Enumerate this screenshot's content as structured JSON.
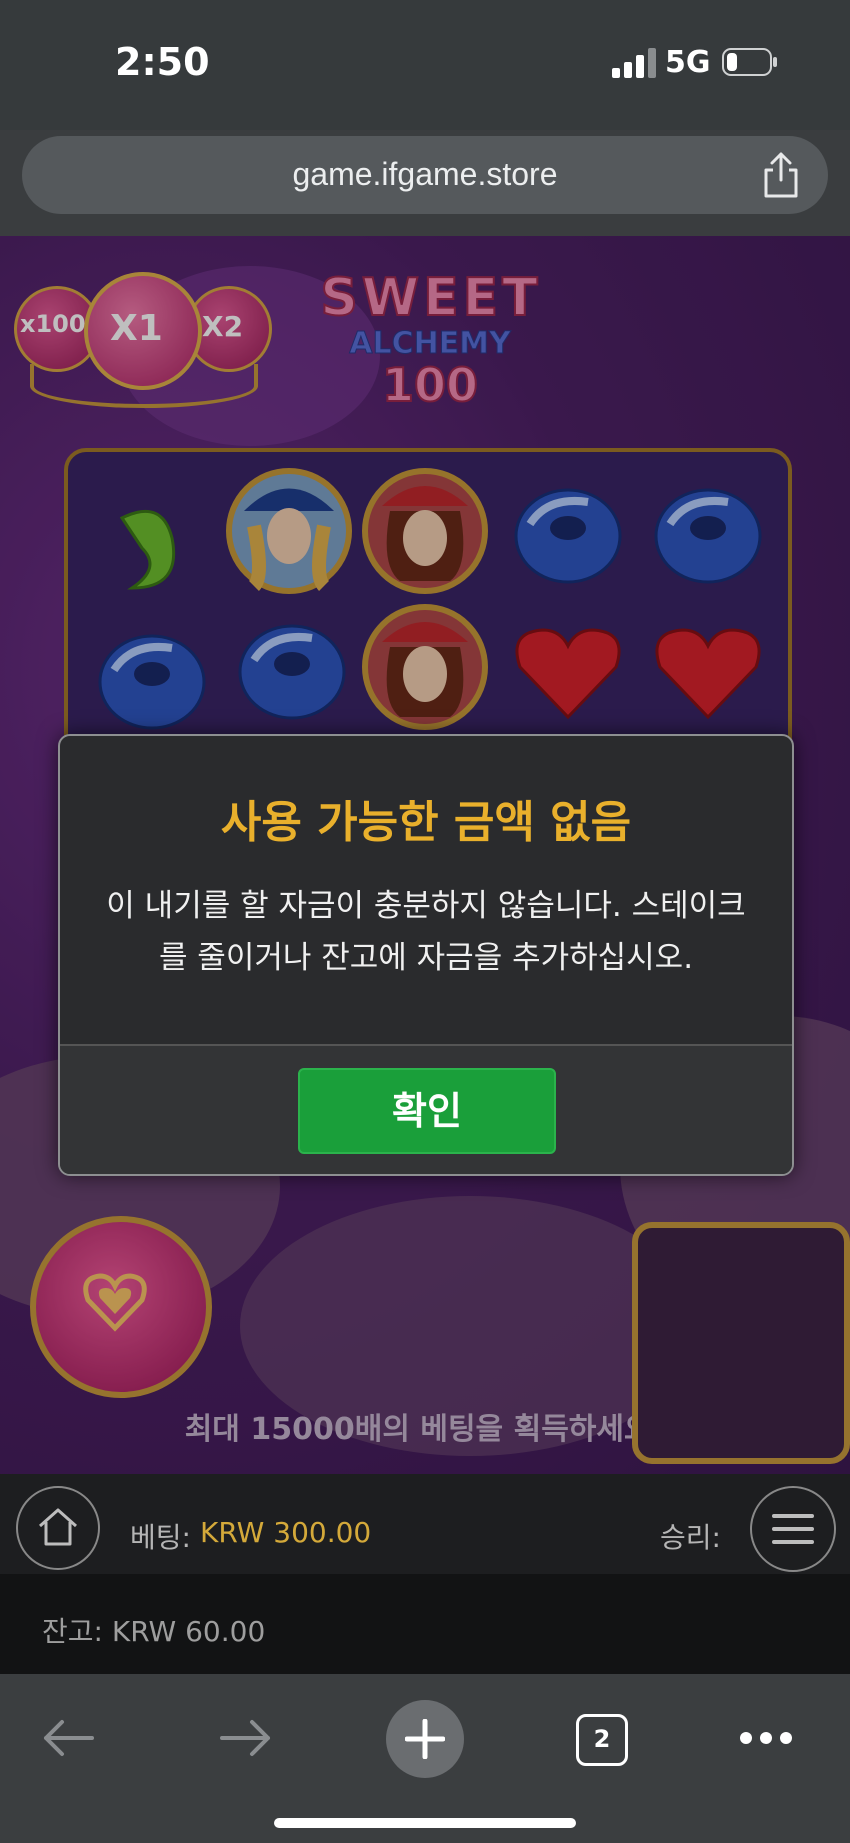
{
  "status_bar": {
    "time": "2:50",
    "network": "5G",
    "signal_icon": "cellular-signal-icon",
    "battery_icon": "battery-low-icon"
  },
  "browser": {
    "url": "game.ifgame.store",
    "share_icon": "share-icon"
  },
  "game": {
    "multipliers": [
      "x100",
      "X1",
      "X2"
    ],
    "logo_lines": [
      "SWEET",
      "ALCHEMY",
      "100"
    ],
    "promo_text": "최대 15000배의 베팅을 획득하세요!",
    "bottom_bar": {
      "bet_label": "베팅:",
      "bet_value": "KRW 300.00",
      "win_label": "승리:",
      "balance": "잔고: KRW 60.00"
    }
  },
  "dialog": {
    "title": "사용 가능한 금액 없음",
    "message": "이 내기를 할 자금이 충분하지 않습니다. 스테이크를 줄이거나 잔고에 자금을 추가하십시오.",
    "ok_label": "확인"
  },
  "toolbar": {
    "tab_count": "2"
  },
  "colors": {
    "title": "#e9b02c",
    "ok_button": "#1a9f3a",
    "bet_value": "#d4a93a"
  }
}
